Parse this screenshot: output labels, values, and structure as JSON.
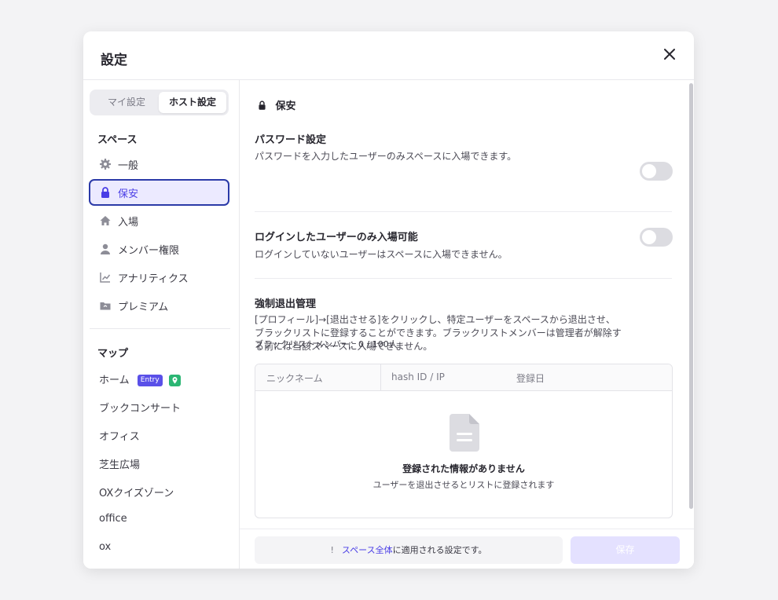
{
  "modal": {
    "title": "設定",
    "close_icon": "close-icon"
  },
  "sidebar": {
    "tabs": [
      {
        "label": "マイ設定",
        "active": false
      },
      {
        "label": "ホスト設定",
        "active": true
      }
    ],
    "space_section": "スペース",
    "items": [
      {
        "label": "一般",
        "icon": "gear-icon",
        "active": false
      },
      {
        "label": "保安",
        "icon": "lock-icon",
        "active": true
      },
      {
        "label": "入場",
        "icon": "home-icon",
        "active": false
      },
      {
        "label": "メンバー権限",
        "icon": "user-icon",
        "active": false
      },
      {
        "label": "アナリティクス",
        "icon": "chart-icon",
        "active": false
      },
      {
        "label": "プレミアム",
        "icon": "folder-icon",
        "active": false
      }
    ],
    "map_section": "マップ",
    "maps": [
      {
        "label": "ホーム",
        "badge": "Entry"
      },
      {
        "label": "ブックコンサート"
      },
      {
        "label": "オフィス"
      },
      {
        "label": "芝生広場"
      },
      {
        "label": "OXクイズゾーン"
      },
      {
        "label": "office"
      },
      {
        "label": "ox"
      }
    ]
  },
  "main": {
    "heading": "保安",
    "password": {
      "title": "パスワード設定",
      "desc": "パスワードを入力したユーザーのみスペースに入場できます。",
      "enabled": false
    },
    "login_only": {
      "title": "ログインしたユーザーのみ入場可能",
      "desc": "ログインしていないユーザーはスペースに入場できません。",
      "enabled": false
    },
    "kick": {
      "title": "強制退出管理",
      "desc_lines": [
        "[プロフィール]→[退出させる]をクリックし、特定ユーザーをスペースから退出させ、",
        "ブラックリストに登録することができます。ブラックリストメンバーは管理者が解除す",
        "る前には当該スペースに入場できません。"
      ],
      "count": "ブラックリストメンバー：0 / 100人",
      "columns": [
        "ニックネーム",
        "hash ID / IP",
        "登録日"
      ],
      "empty_title": "登録された情報がありません",
      "empty_desc": "ユーザーを退出させるとリストに登録されます"
    },
    "footer": {
      "notice_icon": "!",
      "notice_link": "スペース全体",
      "notice_rest": "に適用される設定です。",
      "save_label": "保存"
    }
  },
  "colors": {
    "accent": "#4a3ee6",
    "active_border": "#2b3aa8",
    "active_bg": "#eceaff",
    "toggle_off": "#dcdce1",
    "save_disabled": "#e4e1ff",
    "badge_entry": "#5a50e8",
    "badge_green": "#2bb673"
  }
}
